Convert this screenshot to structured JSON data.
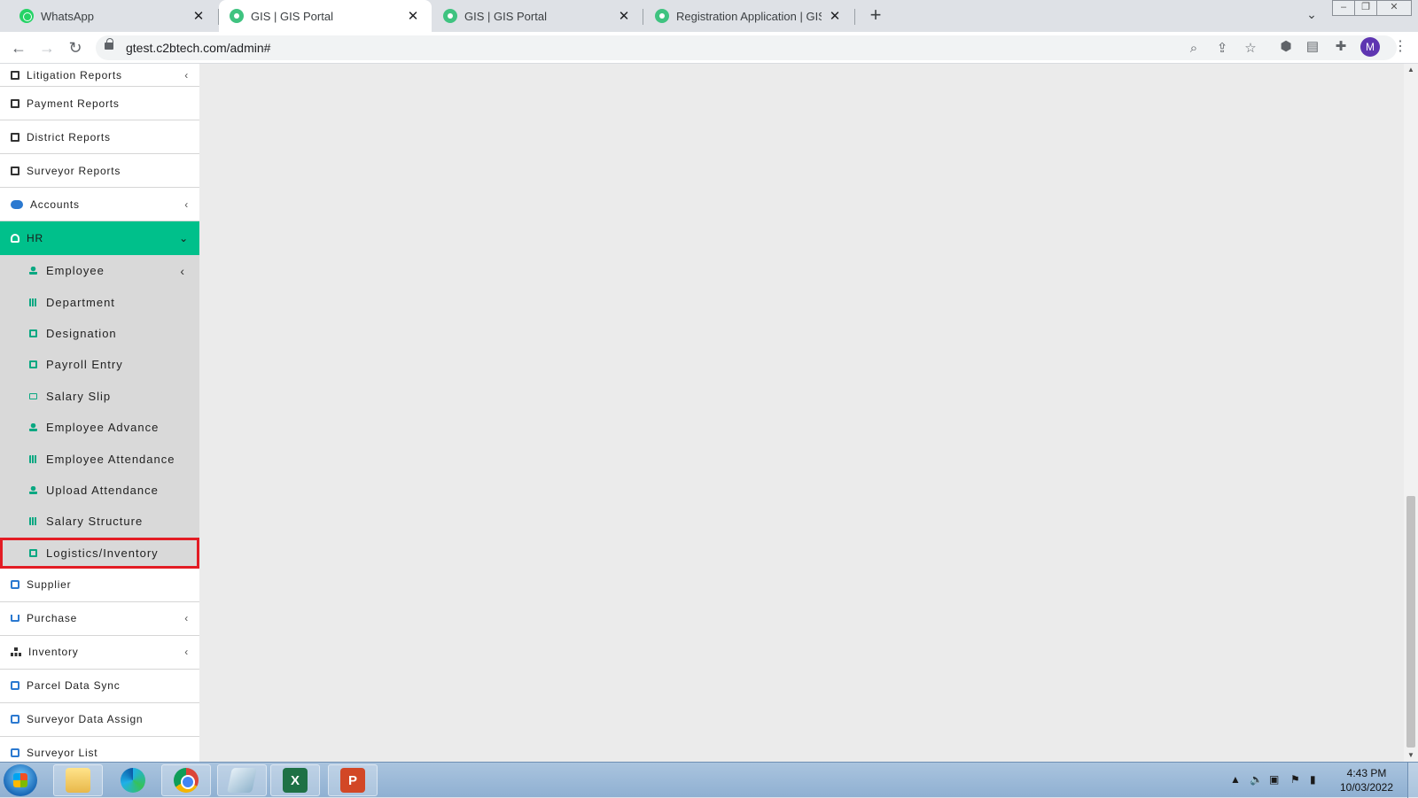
{
  "browser": {
    "tabs": [
      {
        "title": "WhatsApp",
        "favicon": "whatsapp-icon",
        "active": false
      },
      {
        "title": "GIS | GIS Portal",
        "favicon": "gis-portal-icon",
        "active": true
      },
      {
        "title": "GIS | GIS Portal",
        "favicon": "gis-portal-icon",
        "active": false
      },
      {
        "title": "Registration Application | GIS Por",
        "favicon": "gis-portal-icon",
        "active": false
      }
    ],
    "new_tab_glyph": "+",
    "close_glyph": "✕",
    "url": "gtest.c2btech.com/admin#",
    "profile_initial": "M"
  },
  "sidebar": {
    "items_top": [
      {
        "label": "Litigation Reports",
        "icon": "report-icon",
        "has_submenu": true
      },
      {
        "label": "Payment Reports",
        "icon": "report-icon",
        "has_submenu": false
      },
      {
        "label": "District Reports",
        "icon": "report-icon",
        "has_submenu": false
      },
      {
        "label": "Surveyor Reports",
        "icon": "report-icon",
        "has_submenu": false
      },
      {
        "label": "Accounts",
        "icon": "piggy-bank-icon",
        "has_submenu": true
      }
    ],
    "hr": {
      "label": "HR",
      "icon": "id-badge-icon",
      "expanded": true,
      "color": "#00c08b"
    },
    "hr_items": [
      {
        "label": "Employee",
        "icon": "user-plus-icon",
        "has_submenu": true
      },
      {
        "label": "Department",
        "icon": "grid-icon"
      },
      {
        "label": "Designation",
        "icon": "trophy-icon"
      },
      {
        "label": "Payroll Entry",
        "icon": "calculator-icon"
      },
      {
        "label": "Salary Slip",
        "icon": "ticket-icon"
      },
      {
        "label": "Employee Advance",
        "icon": "user-icon"
      },
      {
        "label": "Employee Attendance",
        "icon": "users-icon"
      },
      {
        "label": "Upload Attendance",
        "icon": "anchor-icon"
      },
      {
        "label": "Salary Structure",
        "icon": "table-icon"
      },
      {
        "label": "Logistics/Inventory",
        "icon": "archive-icon",
        "highlighted": true
      }
    ],
    "items_bottom": [
      {
        "label": "Supplier",
        "icon": "truck-icon",
        "has_submenu": false
      },
      {
        "label": "Purchase",
        "icon": "cart-icon",
        "has_submenu": true
      },
      {
        "label": "Inventory",
        "icon": "sitemap-icon",
        "has_submenu": true
      },
      {
        "label": "Parcel Data Sync",
        "icon": "truck-icon",
        "has_submenu": false
      },
      {
        "label": "Surveyor Data Assign",
        "icon": "truck-icon",
        "has_submenu": false
      },
      {
        "label": "Surveyor List",
        "icon": "truck-icon",
        "has_submenu": false
      }
    ],
    "chevron_left": "‹",
    "chevron_down": "⌄",
    "highlight_color": "#e31c24"
  },
  "taskbar": {
    "apps": [
      "file-explorer-icon",
      "edge-icon",
      "chrome-icon",
      "notepad-icon",
      "excel-icon",
      "powerpoint-icon"
    ],
    "excel_letter": "X",
    "ppt_letter": "P",
    "time": "4:43 PM",
    "date": "10/03/2022"
  }
}
